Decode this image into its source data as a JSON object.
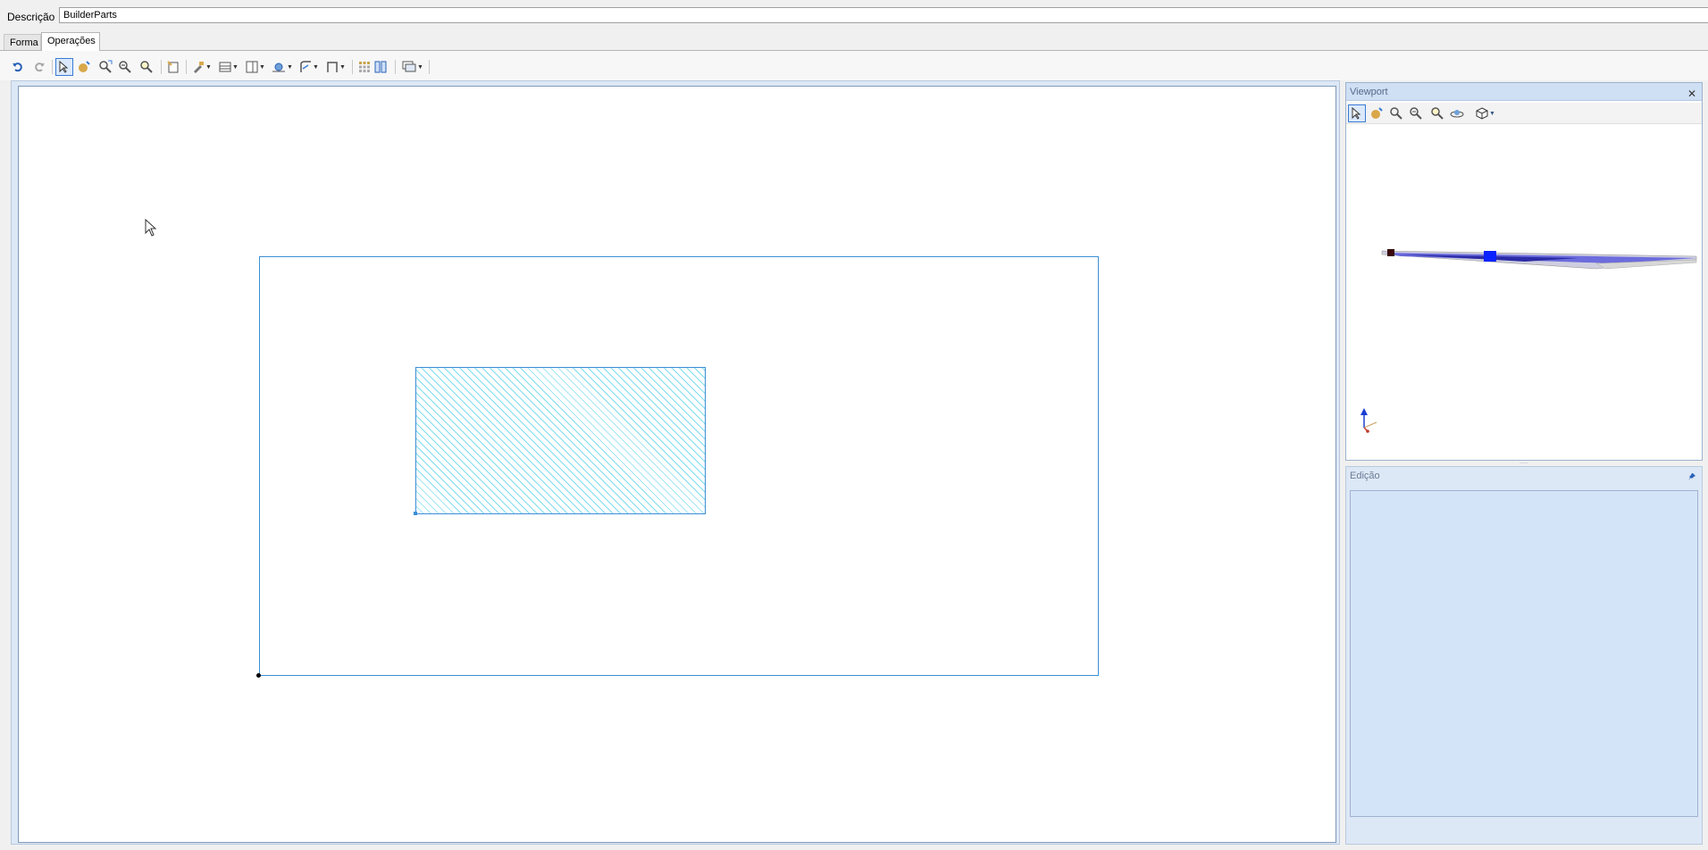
{
  "description": {
    "label": "Descrição",
    "value": "BuilderParts"
  },
  "tabs": [
    {
      "label": "Forma",
      "active": false
    },
    {
      "label": "Operações",
      "active": true
    }
  ],
  "toolbar": {
    "icons": [
      "undo-icon",
      "redo-icon",
      "select-pointer-icon",
      "pan-icon",
      "zoom-window-icon",
      "zoom-out-icon",
      "zoom-in-icon",
      "new-document-icon",
      "tool-dropdown-icon",
      "layout-dropdown-icon",
      "panel-dropdown-icon",
      "shape-dropdown-icon",
      "curve-dropdown-icon",
      "frame-dropdown-icon",
      "grid-icon",
      "columns-icon",
      "view-dropdown-icon"
    ]
  },
  "viewport_panel": {
    "title": "Viewport",
    "close_glyph": "✕"
  },
  "edit_panel": {
    "title": "Edição"
  },
  "colors": {
    "accent": "#3b8fd6",
    "hatch": "#7ddcf0",
    "panel_bg": "#dde8f6"
  }
}
